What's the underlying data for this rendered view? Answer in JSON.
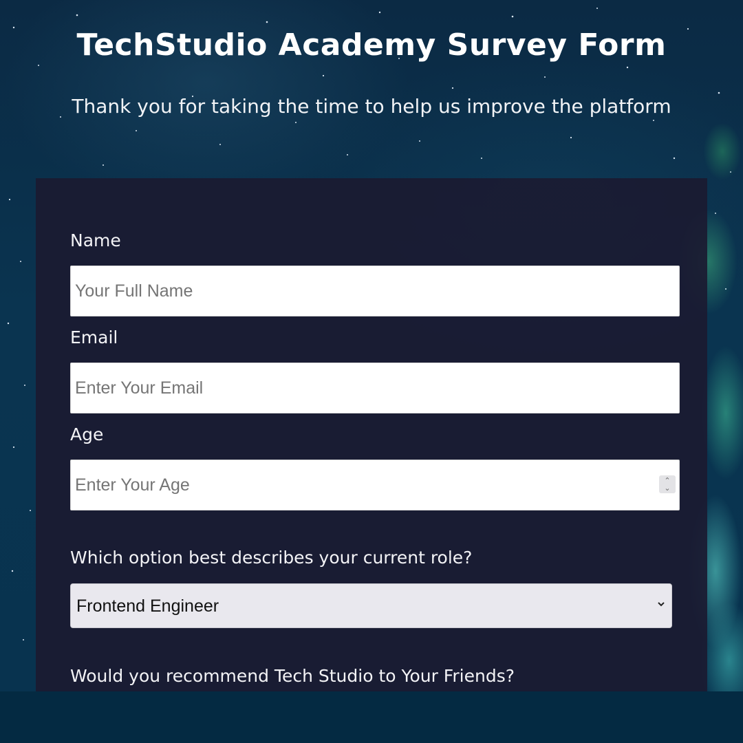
{
  "header": {
    "title": "TechStudio Academy Survey Form",
    "subtitle": "Thank you for taking the time to help us improve the platform"
  },
  "form": {
    "name": {
      "label": "Name",
      "placeholder": "Your Full Name",
      "value": ""
    },
    "email": {
      "label": "Email",
      "placeholder": "Enter Your Email",
      "value": ""
    },
    "age": {
      "label": "Age",
      "placeholder": "Enter Your Age",
      "value": ""
    },
    "role": {
      "label": "Which option best describes your current role?",
      "selected": "Frontend Engineer"
    },
    "recommend": {
      "label": "Would you recommend Tech Studio to Your Friends?"
    }
  },
  "icons": {
    "spinner": "number-spinner-icon",
    "select": "chevron-down-icon"
  },
  "colors": {
    "background": "#0a3450",
    "card": "#1b1b32",
    "text": "#ffffff",
    "input": "#ffffff",
    "select": "#e9e8ee"
  }
}
